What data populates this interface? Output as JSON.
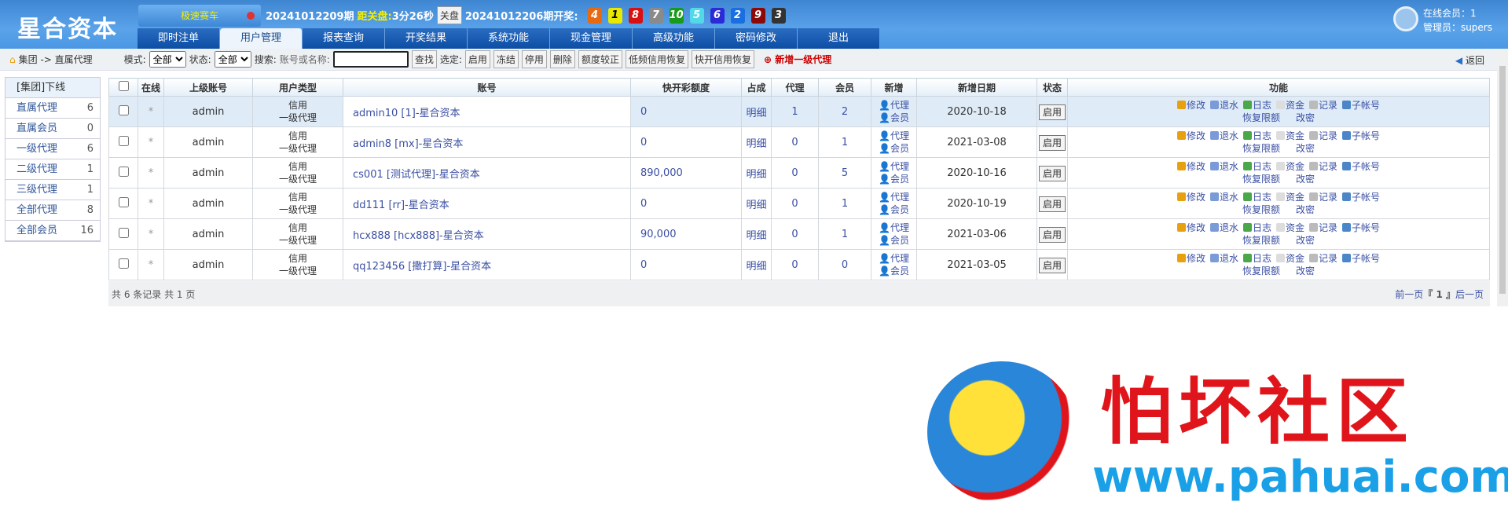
{
  "header": {
    "logo": "星合资本",
    "game": "极速赛车",
    "period": "20241012209期",
    "close_label": "距关盘:",
    "close_time": "3分26秒",
    "close_btn": "关盘",
    "last_period": "20241012206期开奖:",
    "balls": [
      {
        "n": "4",
        "c": "#e86a10"
      },
      {
        "n": "1",
        "c": "#e8e800"
      },
      {
        "n": "8",
        "c": "#d81010"
      },
      {
        "n": "7",
        "c": "#8a8a8a"
      },
      {
        "n": "10",
        "c": "#1a9a1a"
      },
      {
        "n": "5",
        "c": "#52d8e8"
      },
      {
        "n": "6",
        "c": "#2a2ad8"
      },
      {
        "n": "2",
        "c": "#1a6ee0"
      },
      {
        "n": "9",
        "c": "#8a0a0a"
      },
      {
        "n": "3",
        "c": "#333333"
      }
    ],
    "online": "在线会员：1",
    "admin": "管理员：supers"
  },
  "tabs": [
    "即时注单",
    "用户管理",
    "报表查询",
    "开奖结果",
    "系统功能",
    "现金管理",
    "高级功能",
    "密码修改",
    "退出"
  ],
  "toolbar": {
    "crumb": "集团 -> 直属代理",
    "mode_label": "模式:",
    "mode": "全部",
    "status_label": "状态:",
    "status": "全部",
    "search_label": "搜索:",
    "name_label": "账号或名称:",
    "search_value": "",
    "find": "查找",
    "select_label": "选定:",
    "btns": [
      "启用",
      "冻结",
      "停用",
      "删除",
      "额度较正",
      "低频信用恢复",
      "快开信用恢复"
    ],
    "add": "新增一级代理",
    "back": "返回"
  },
  "sidebar": {
    "title": "[集团]下线",
    "items": [
      {
        "l": "直属代理",
        "n": "6"
      },
      {
        "l": "直属会员",
        "n": "0"
      },
      {
        "l": "一级代理",
        "n": "6"
      },
      {
        "l": "二级代理",
        "n": "1"
      },
      {
        "l": "三级代理",
        "n": "1"
      },
      {
        "l": "全部代理",
        "n": "8"
      },
      {
        "l": "全部会员",
        "n": "16"
      }
    ]
  },
  "table": {
    "headers": [
      "",
      "在线",
      "上级账号",
      "用户类型",
      "账号",
      "快开彩额度",
      "占成",
      "代理",
      "会员",
      "新增",
      "新增日期",
      "状态",
      "功能"
    ],
    "rows": [
      {
        "on": "*",
        "parent": "admin",
        "t1": "信用",
        "t2": "一级代理",
        "acct": "admin10 [1]-星合资本",
        "limit": "0",
        "share": "明细",
        "agents": "1",
        "members": "2",
        "date": "2020-10-18",
        "status": "启用"
      },
      {
        "on": "*",
        "parent": "admin",
        "t1": "信用",
        "t2": "一级代理",
        "acct": "admin8 [mx]-星合资本",
        "limit": "0",
        "share": "明细",
        "agents": "0",
        "members": "1",
        "date": "2021-03-08",
        "status": "启用"
      },
      {
        "on": "*",
        "parent": "admin",
        "t1": "信用",
        "t2": "一级代理",
        "acct": "cs001 [测试代理]-星合资本",
        "limit": "890,000",
        "share": "明细",
        "agents": "0",
        "members": "5",
        "date": "2020-10-16",
        "status": "启用"
      },
      {
        "on": "*",
        "parent": "admin",
        "t1": "信用",
        "t2": "一级代理",
        "acct": "dd111 [rr]-星合资本",
        "limit": "0",
        "share": "明细",
        "agents": "0",
        "members": "1",
        "date": "2020-10-19",
        "status": "启用"
      },
      {
        "on": "*",
        "parent": "admin",
        "t1": "信用",
        "t2": "一级代理",
        "acct": "hcx888 [hcx888]-星合资本",
        "limit": "90,000",
        "share": "明细",
        "agents": "0",
        "members": "1",
        "date": "2021-03-06",
        "status": "启用"
      },
      {
        "on": "*",
        "parent": "admin",
        "t1": "信用",
        "t2": "一级代理",
        "acct": "qq123456 [撒打算]-星合资本",
        "limit": "0",
        "share": "明细",
        "agents": "0",
        "members": "0",
        "date": "2021-03-05",
        "status": "启用"
      }
    ],
    "new_agent": "代理",
    "new_member": "会员",
    "funcs": [
      {
        "l": "修改",
        "c": "#e6a010"
      },
      {
        "l": "退水",
        "c": "#7a9ad8"
      },
      {
        "l": "日志",
        "c": "#4aa84a"
      },
      {
        "l": "资金",
        "c": "#ddd"
      },
      {
        "l": "记录",
        "c": "#bbb"
      },
      {
        "l": "子帐号",
        "c": "#4a86c8"
      }
    ],
    "funcs2": [
      "恢复限额",
      "改密"
    ]
  },
  "footer": {
    "summary": "共 6 条记录 共 1 页",
    "prev": "前一页",
    "page": "『 1 』",
    "next": "后一页"
  },
  "watermark": {
    "text": "怕坏社区",
    "url": "www.pahuai.com"
  }
}
